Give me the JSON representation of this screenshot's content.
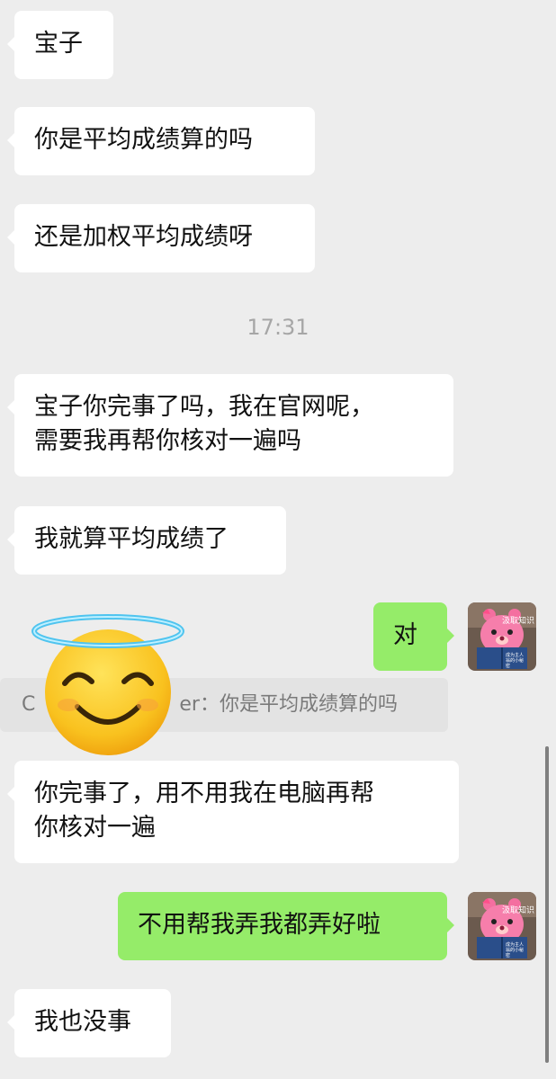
{
  "messages": [
    {
      "side": "left",
      "text": "宝子"
    },
    {
      "side": "left",
      "text": "你是平均成绩算的吗"
    },
    {
      "side": "left",
      "text": "还是加权平均成绩呀"
    },
    {
      "side": "left",
      "text": "宝子你完事了吗，我在官网呢，\n需要我再帮你核对一遍吗"
    },
    {
      "side": "left",
      "text": "我就算平均成绩了"
    },
    {
      "side": "right",
      "text": "对"
    },
    {
      "side": "left",
      "text": "你完事了，用不用我在电脑再帮\n你核对一遍"
    },
    {
      "side": "right",
      "text": "不用帮我弄我都弄好啦"
    },
    {
      "side": "left",
      "text": "我也没事"
    }
  ],
  "timestamp": "17:31",
  "quote": {
    "prefix": "C",
    "suffix": "er：你是平均成绩算的吗"
  },
  "avatar": {
    "caption": "汲取知识",
    "book_text": "成为主人翁的小秘密"
  },
  "sticker": {
    "name": "smiling-face-with-halo-emoji"
  },
  "colors": {
    "background": "#ededed",
    "incoming_bubble": "#ffffff",
    "outgoing_bubble": "#95ec69"
  }
}
